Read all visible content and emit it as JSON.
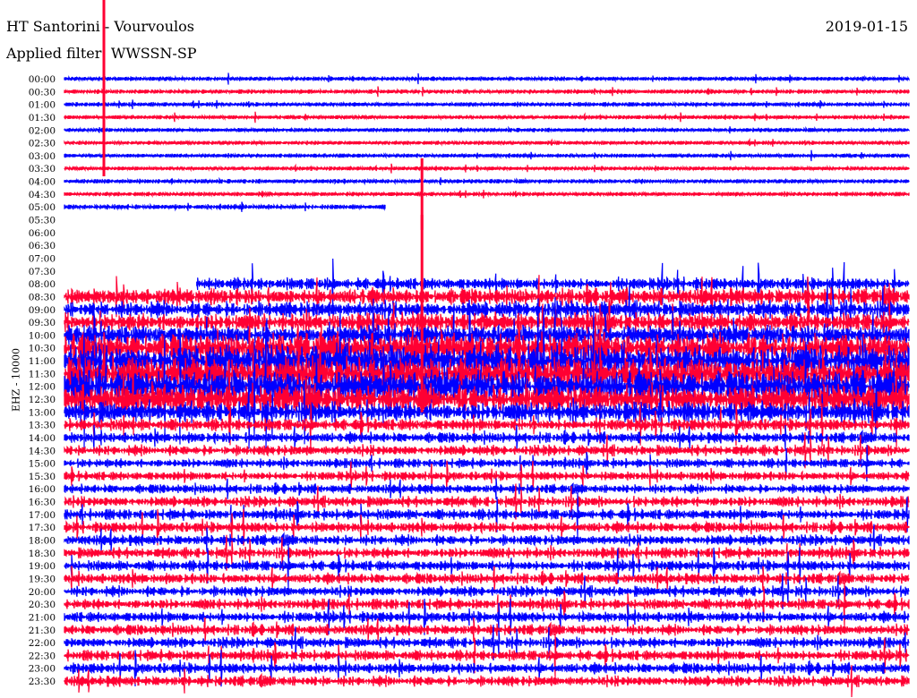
{
  "header": {
    "title": "HT Santorini - Vourvoulos",
    "filter": "Applied filter: WWSSN-SP",
    "date": "2019-01-15"
  },
  "chart_data": {
    "type": "line",
    "subtype": "helicorder",
    "title": "HT Santorini - Vourvoulos",
    "ylabel": "EHZ - 10000",
    "minutes_per_row": 30,
    "colors": [
      "#0000ff",
      "#ff0033"
    ],
    "rows": [
      {
        "label": "00:00",
        "amp": 1.5
      },
      {
        "label": "00:30",
        "amp": 1.5
      },
      {
        "label": "01:00",
        "amp": 1.5
      },
      {
        "label": "01:30",
        "amp": 1.3
      },
      {
        "label": "02:00",
        "amp": 1.3
      },
      {
        "label": "02:30",
        "amp": 1.3
      },
      {
        "label": "03:00",
        "amp": 1.3
      },
      {
        "label": "03:30",
        "amp": 1.3
      },
      {
        "label": "04:00",
        "amp": 1.5
      },
      {
        "label": "04:30",
        "amp": 1.5
      },
      {
        "label": "05:00",
        "amp": 2,
        "end_min": 11.4
      },
      {
        "label": "05:30",
        "amp": 0,
        "end_min": 0
      },
      {
        "label": "06:00",
        "amp": 0,
        "end_min": 0
      },
      {
        "label": "06:30",
        "amp": 0,
        "end_min": 0
      },
      {
        "label": "07:00",
        "amp": 0,
        "end_min": 0
      },
      {
        "label": "07:30",
        "amp": 0,
        "end_min": 0
      },
      {
        "label": "08:00",
        "amp": 7,
        "start_min": 4.7
      },
      {
        "label": "08:30",
        "amp": 10
      },
      {
        "label": "09:00",
        "amp": 10
      },
      {
        "label": "09:30",
        "amp": 11
      },
      {
        "label": "10:00",
        "amp": 12
      },
      {
        "label": "10:30",
        "amp": 18
      },
      {
        "label": "11:00",
        "amp": 20
      },
      {
        "label": "11:30",
        "amp": 20
      },
      {
        "label": "12:00",
        "amp": 20
      },
      {
        "label": "12:30",
        "amp": 18
      },
      {
        "label": "13:00",
        "amp": 12
      },
      {
        "label": "13:30",
        "amp": 7
      },
      {
        "label": "14:00",
        "amp": 6
      },
      {
        "label": "14:30",
        "amp": 6
      },
      {
        "label": "15:00",
        "amp": 5
      },
      {
        "label": "15:30",
        "amp": 5
      },
      {
        "label": "16:00",
        "amp": 5
      },
      {
        "label": "16:30",
        "amp": 6
      },
      {
        "label": "17:00",
        "amp": 6
      },
      {
        "label": "17:30",
        "amp": 6
      },
      {
        "label": "18:00",
        "amp": 6
      },
      {
        "label": "18:30",
        "amp": 6
      },
      {
        "label": "19:00",
        "amp": 6
      },
      {
        "label": "19:30",
        "amp": 6
      },
      {
        "label": "20:00",
        "amp": 6
      },
      {
        "label": "20:30",
        "amp": 6
      },
      {
        "label": "21:00",
        "amp": 6
      },
      {
        "label": "21:30",
        "amp": 6
      },
      {
        "label": "22:00",
        "amp": 6
      },
      {
        "label": "22:30",
        "amp": 6
      },
      {
        "label": "23:00",
        "amp": 6
      },
      {
        "label": "23:30",
        "amp": 6
      }
    ],
    "events": [
      {
        "row": 1,
        "minute": 1.4,
        "amp": 110
      },
      {
        "row": 9,
        "minute": 12.7,
        "amp": 40
      },
      {
        "row": 19,
        "minute": 12.7,
        "amp": 120
      }
    ]
  }
}
